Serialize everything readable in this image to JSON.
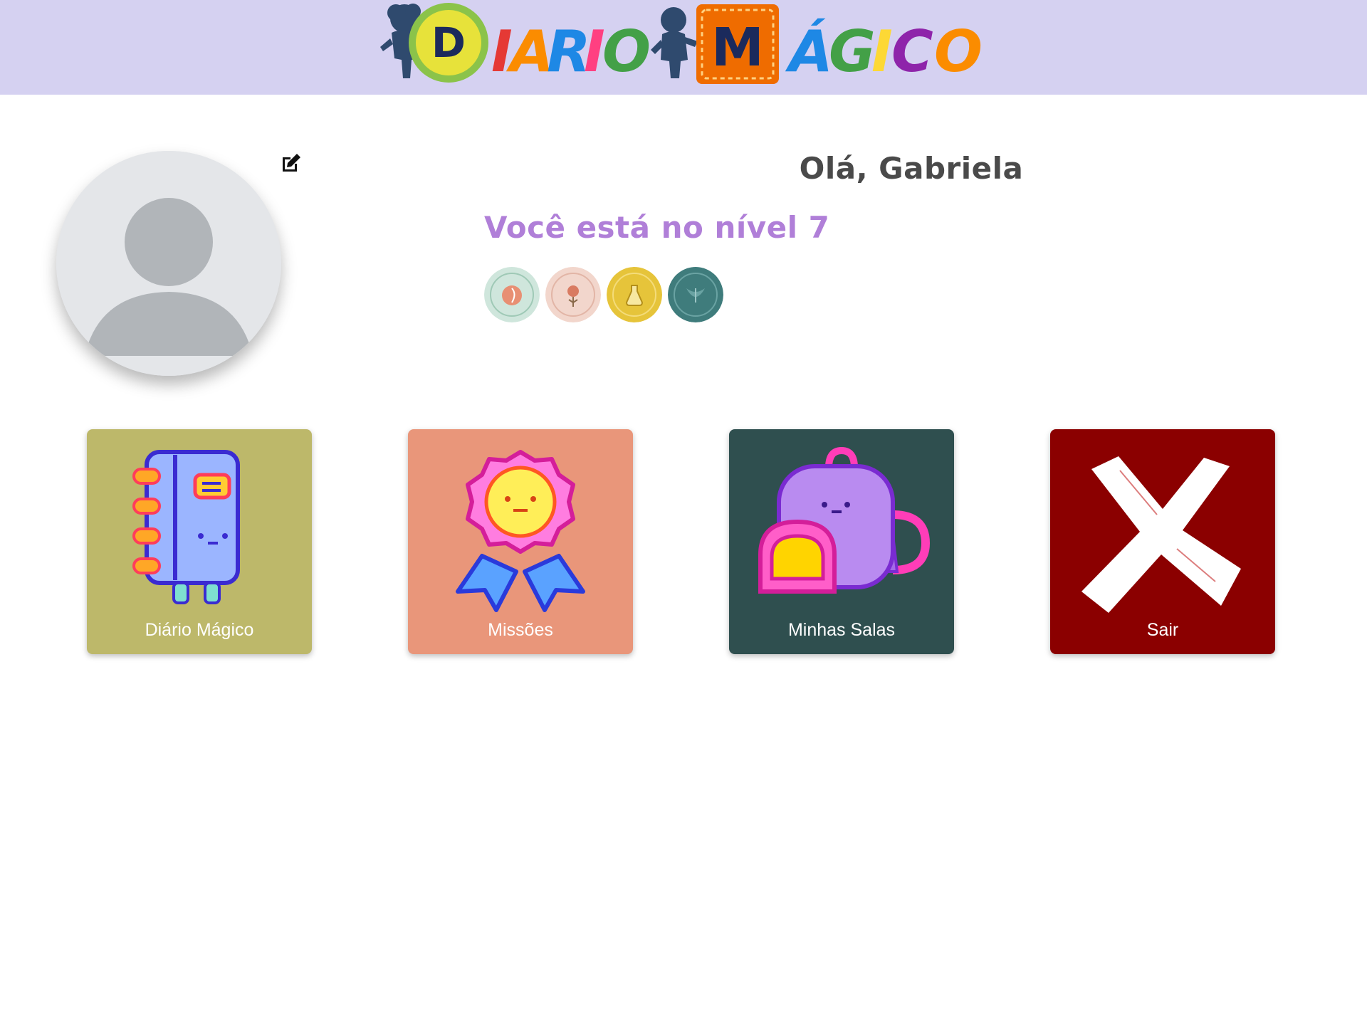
{
  "header": {
    "logo_text": "DIARIO MÁGICO",
    "background": "#d5d1f1"
  },
  "profile": {
    "avatar_icon": "user-silhouette-icon",
    "edit_icon": "edit-icon",
    "greeting": "Olá, Gabriela",
    "level_text": "Você está no nível 7",
    "badges": [
      {
        "name": "badge-natural-product",
        "color": "#cfe6dc"
      },
      {
        "name": "badge-organic-flower",
        "color": "#f2d6cc"
      },
      {
        "name": "badge-gold-potion",
        "color": "#e6c43a"
      },
      {
        "name": "badge-teal-leaf",
        "color": "#3f7c7c"
      }
    ]
  },
  "menu": {
    "tiles": [
      {
        "label": "Diário Mágico",
        "icon": "notebook-icon",
        "color": "#bdb86a"
      },
      {
        "label": "Missões",
        "icon": "medal-icon",
        "color": "#e9967a"
      },
      {
        "label": "Minhas Salas",
        "icon": "backpack-icon",
        "color": "#2f4f4f"
      },
      {
        "label": "Sair",
        "icon": "close-x-icon",
        "color": "#8b0000"
      }
    ]
  }
}
